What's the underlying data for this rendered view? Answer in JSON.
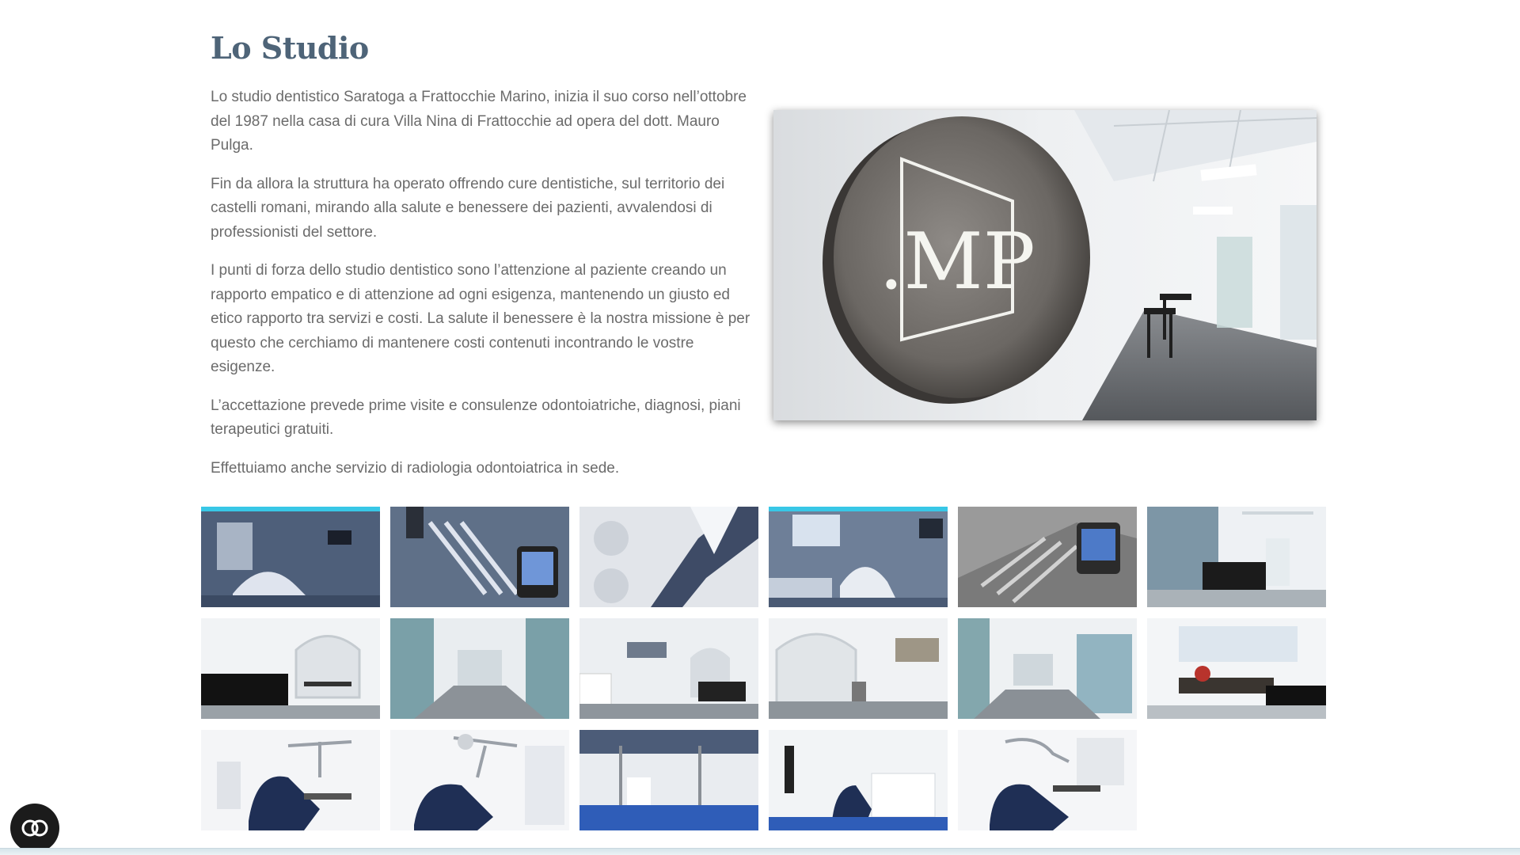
{
  "section": {
    "title": "Lo Studio"
  },
  "paragraphs": [
    "Lo studio dentistico Saratoga a Frattocchie Marino, inizia il suo corso nell’ottobre del 1987 nella casa di cura Villa Nina di Frattocchie ad opera del dott. Mauro Pulga.",
    "Fin da allora la struttura ha operato offrendo cure dentistiche, sul territorio dei castelli romani, mirando alla salute e benessere dei pazienti, avvalendosi di professionisti del settore.",
    "I punti di forza dello studio dentistico  sono l’attenzione al paziente creando un rapporto empatico e di attenzione ad ogni esigenza, mantenendo un giusto ed etico rapporto tra servizi e costi. La salute il benessere è la nostra missione è per questo che cerchiamo di mantenere costi contenuti incontrando le vostre esigenze.",
    "L’accettazione prevede prime visite e consulenze odontoiatriche, diagnosi, piani terapeutici gratuiti.",
    "Effettuiamo anche servizio di radiologia odontoiatrica in sede."
  ],
  "hero": {
    "logo_text": ".MP"
  },
  "gallery": {
    "thumbnails": [
      {
        "name": "gallery-thumb-1"
      },
      {
        "name": "gallery-thumb-2"
      },
      {
        "name": "gallery-thumb-3"
      },
      {
        "name": "gallery-thumb-4"
      },
      {
        "name": "gallery-thumb-5"
      },
      {
        "name": "gallery-thumb-6"
      },
      {
        "name": "gallery-thumb-7"
      },
      {
        "name": "gallery-thumb-8"
      },
      {
        "name": "gallery-thumb-9"
      },
      {
        "name": "gallery-thumb-10"
      },
      {
        "name": "gallery-thumb-11"
      },
      {
        "name": "gallery-thumb-12"
      },
      {
        "name": "gallery-thumb-13"
      },
      {
        "name": "gallery-thumb-14"
      },
      {
        "name": "gallery-thumb-15"
      },
      {
        "name": "gallery-thumb-16"
      },
      {
        "name": "gallery-thumb-17"
      }
    ]
  },
  "accessibility": {
    "icon": "accessibility-toggle-icon"
  },
  "colors": {
    "title": "#4e6478",
    "body_text": "#6b6b6b",
    "chair_blue": "#1f2f55",
    "floor_blue": "#2f5db8",
    "ambient_light": "#38c7e6"
  }
}
